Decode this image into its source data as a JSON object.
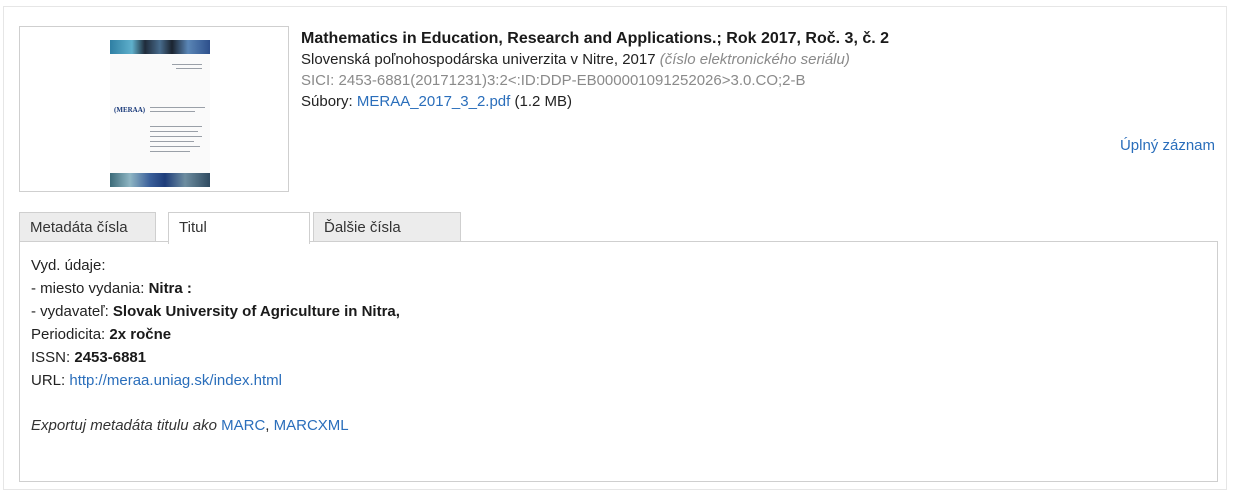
{
  "record": {
    "title": "Mathematics in Education, Research and Applications.; Rok 2017, Roč. 3, č. 2",
    "publisher_line": "Slovenská poľnohospodárska univerzita v Nitre, 2017",
    "publisher_note": "(číslo elektronického seriálu)",
    "sici": "SICI: 2453-6881(20171231)3:2<:ID:DDP-EB000001091252026>3.0.CO;2-B",
    "files_label": "Súbory:",
    "file_name": "MERAA_2017_3_2.pdf",
    "file_size": "(1.2 MB)",
    "full_record_link": "Úplný záznam",
    "cover_title": "(MERAA)"
  },
  "tabs": [
    {
      "label": "Metadáta čísla",
      "active": false
    },
    {
      "label": "Titul",
      "active": true
    },
    {
      "label": "Ďalšie čísla",
      "active": false
    }
  ],
  "panel": {
    "vyd_label": "Vyd. údaje:",
    "place_label": "- miesto vydania:",
    "place_value": "Nitra :",
    "publisher_label": "- vydavateľ:",
    "publisher_value": "Slovak University of Agriculture in Nitra,",
    "periodicity_label": "Periodicita:",
    "periodicity_value": "2x ročne",
    "issn_label": "ISSN:",
    "issn_value": "2453-6881",
    "url_label": "URL:",
    "url_value": "http://meraa.uniag.sk/index.html",
    "export_text": "Exportuj metadáta titulu ako",
    "export_marc": "MARC",
    "export_sep": ",",
    "export_marcxml": "MARCXML"
  },
  "colors": {
    "link": "#2a6ebb",
    "muted": "#8a8a8a",
    "tab_inactive_bg": "#ececec",
    "border": "#cfcfcf"
  }
}
